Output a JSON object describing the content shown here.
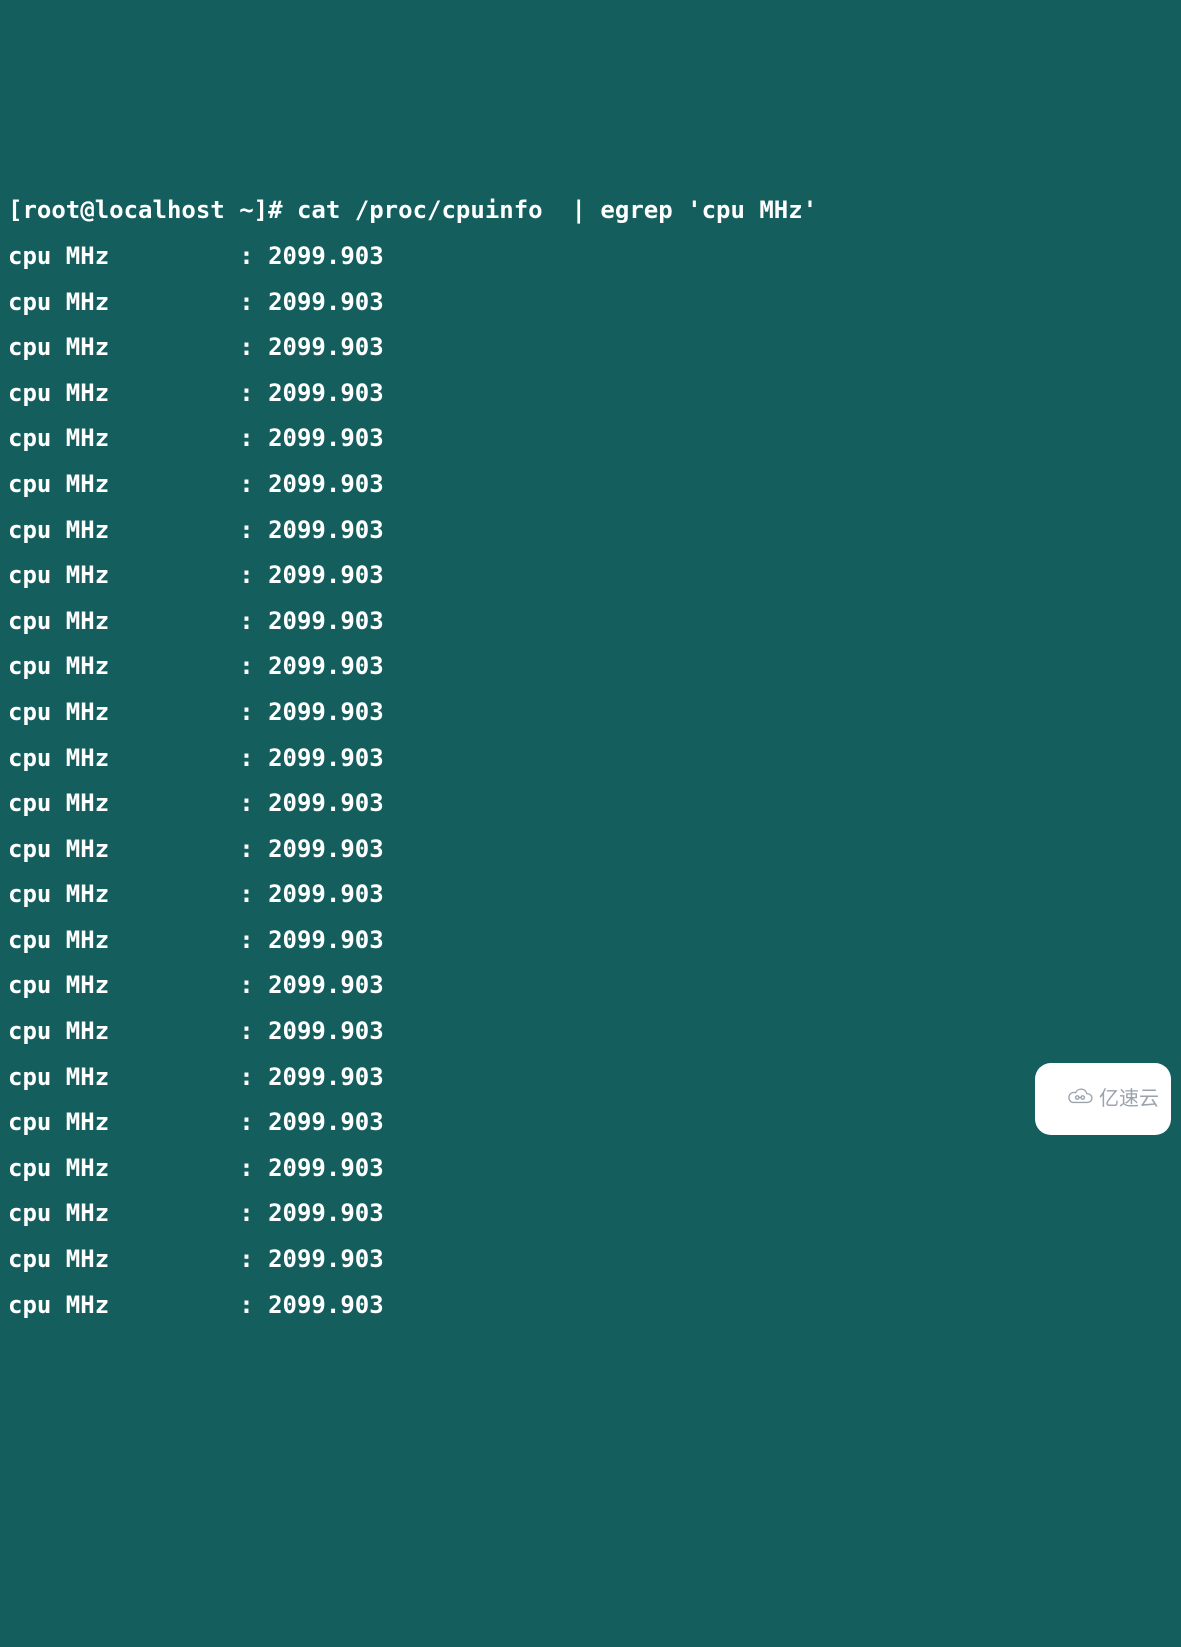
{
  "terminal": {
    "prompt": "[root@localhost ~]# ",
    "command": "cat /proc/cpuinfo  | egrep 'cpu MHz'",
    "output_key": "cpu MHz",
    "output_value": "2099.903",
    "rows": [
      {
        "key": "cpu MHz",
        "value": "2099.903"
      },
      {
        "key": "cpu MHz",
        "value": "2099.903"
      },
      {
        "key": "cpu MHz",
        "value": "2099.903"
      },
      {
        "key": "cpu MHz",
        "value": "2099.903"
      },
      {
        "key": "cpu MHz",
        "value": "2099.903"
      },
      {
        "key": "cpu MHz",
        "value": "2099.903"
      },
      {
        "key": "cpu MHz",
        "value": "2099.903"
      },
      {
        "key": "cpu MHz",
        "value": "2099.903"
      },
      {
        "key": "cpu MHz",
        "value": "2099.903"
      },
      {
        "key": "cpu MHz",
        "value": "2099.903"
      },
      {
        "key": "cpu MHz",
        "value": "2099.903"
      },
      {
        "key": "cpu MHz",
        "value": "2099.903"
      },
      {
        "key": "cpu MHz",
        "value": "2099.903"
      },
      {
        "key": "cpu MHz",
        "value": "2099.903"
      },
      {
        "key": "cpu MHz",
        "value": "2099.903"
      },
      {
        "key": "cpu MHz",
        "value": "2099.903"
      },
      {
        "key": "cpu MHz",
        "value": "2099.903"
      },
      {
        "key": "cpu MHz",
        "value": "2099.903"
      },
      {
        "key": "cpu MHz",
        "value": "2099.903"
      },
      {
        "key": "cpu MHz",
        "value": "2099.903"
      },
      {
        "key": "cpu MHz",
        "value": "2099.903"
      },
      {
        "key": "cpu MHz",
        "value": "2099.903"
      },
      {
        "key": "cpu MHz",
        "value": "2099.903"
      },
      {
        "key": "cpu MHz",
        "value": "2099.903"
      }
    ]
  },
  "watermark": {
    "text": "亿速云",
    "icon": "cloud-icon"
  }
}
